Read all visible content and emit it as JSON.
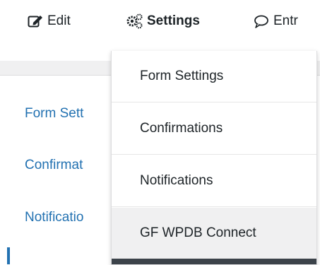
{
  "toolbar": {
    "edit_label": "Edit",
    "edit_icon": "edit-icon",
    "settings_label": "Settings",
    "settings_icon": "gears-icon",
    "entries_label": "Entr",
    "entries_icon": "speech-bubble-icon"
  },
  "sidebar": {
    "items": [
      {
        "label": "Form Sett"
      },
      {
        "label": "Confirmat"
      },
      {
        "label": "Notificatio"
      }
    ]
  },
  "dropdown": {
    "items": [
      {
        "label": "Form Settings"
      },
      {
        "label": "Confirmations"
      },
      {
        "label": "Notifications"
      },
      {
        "label": "GF WPDB Connect"
      }
    ],
    "active_index": 3
  },
  "colors": {
    "link": "#2271b1",
    "text": "#1d2327",
    "menu_hover": "#f0f0f1"
  }
}
